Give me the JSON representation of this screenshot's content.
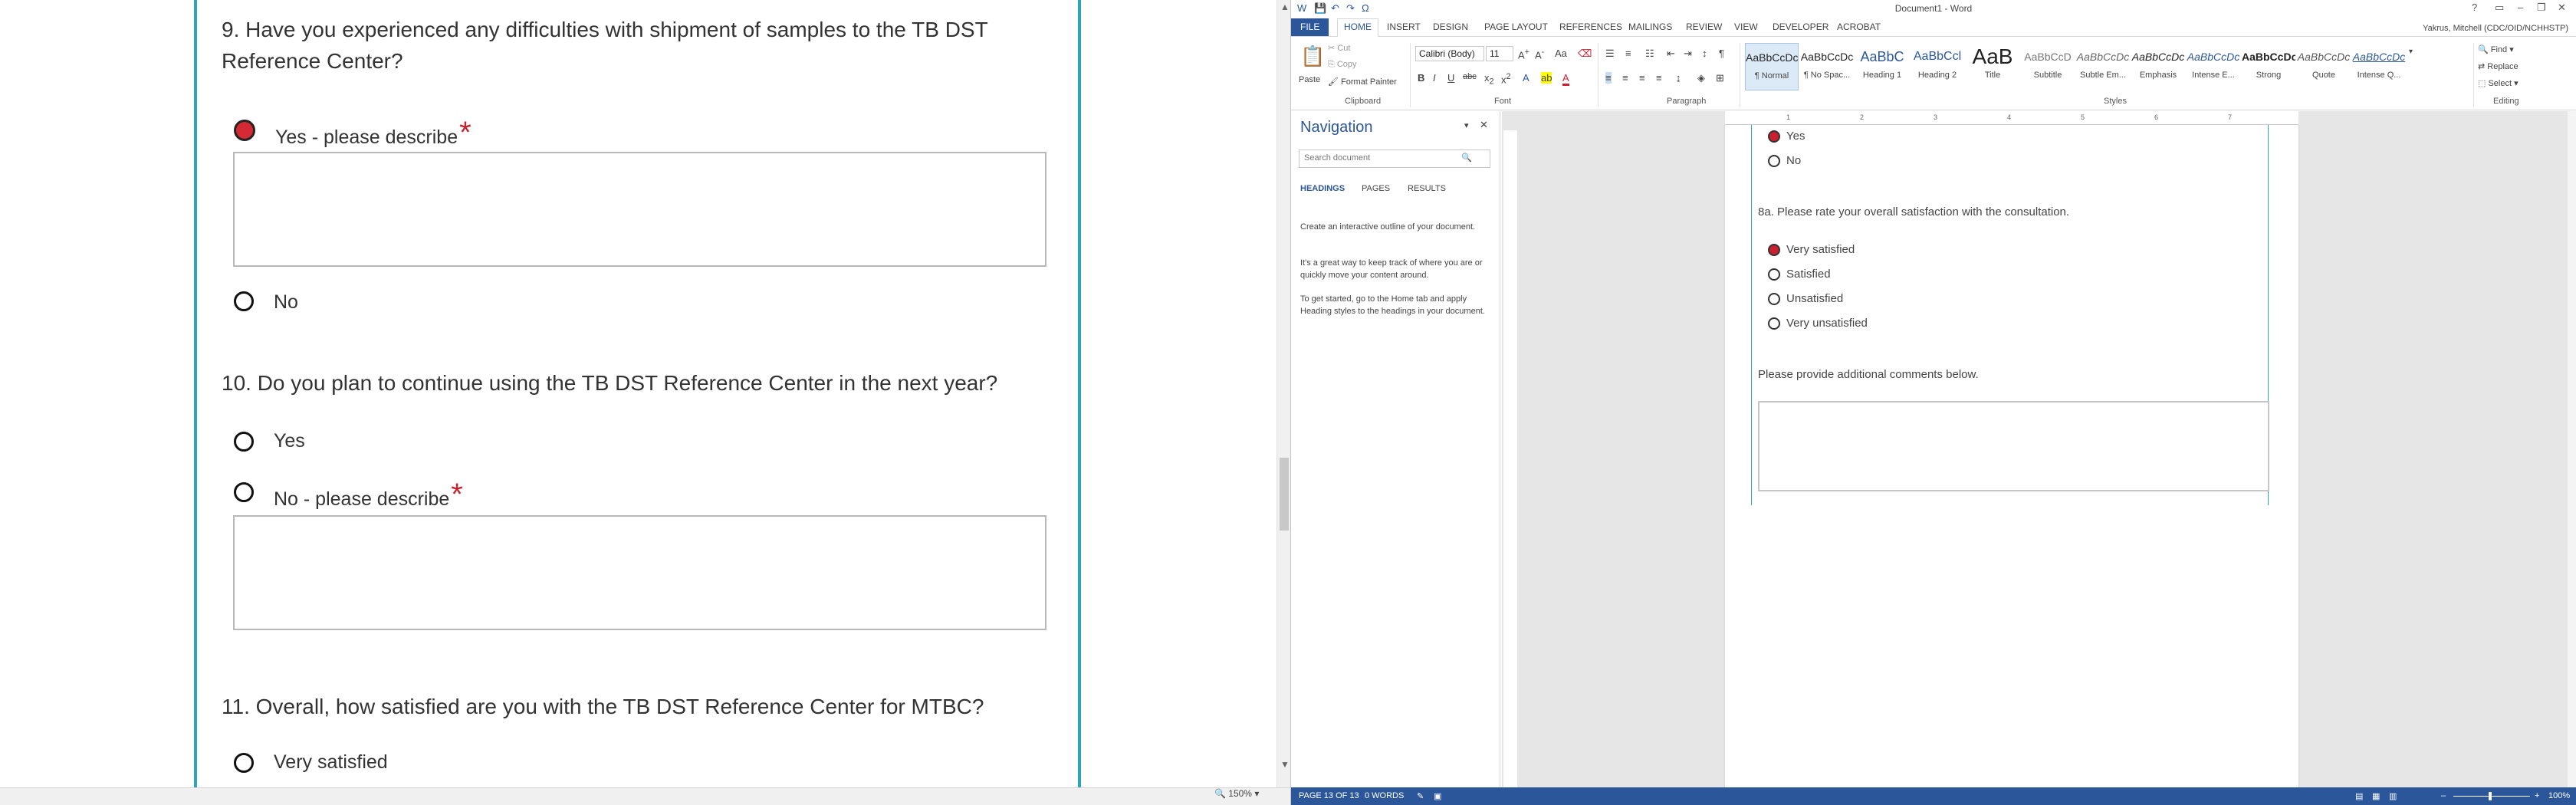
{
  "survey": {
    "q9": {
      "text": "9. Have you experienced any difficulties with shipment of samples to the TB DST Reference Center?",
      "opt_yes": "Yes - please describe",
      "opt_no": "No",
      "required": "*"
    },
    "q10": {
      "text": "10. Do you plan to continue using the TB DST Reference Center in the next year?",
      "opt_yes": "Yes",
      "opt_no": "No - please describe",
      "required": "*"
    },
    "q11": {
      "text": "11. Overall, how satisfied are you with the TB DST Reference Center for MTBC?",
      "opt_very": "Very satisfied"
    }
  },
  "left_status": {
    "zoom": "150%"
  },
  "word": {
    "title": "Document1 - Word",
    "user": "Yakrus, Mitchell (CDC/OID/NCHHSTP)",
    "tabs": [
      "FILE",
      "HOME",
      "INSERT",
      "DESIGN",
      "PAGE LAYOUT",
      "REFERENCES",
      "MAILINGS",
      "REVIEW",
      "VIEW",
      "DEVELOPER",
      "ACROBAT"
    ],
    "clipboard": {
      "paste": "Paste",
      "cut": "Cut",
      "copy": "Copy",
      "format_painter": "Format Painter",
      "label": "Clipboard"
    },
    "font": {
      "name": "Calibri (Body)",
      "size": "11",
      "label": "Font"
    },
    "paragraph": {
      "label": "Paragraph"
    },
    "styles": {
      "label": "Styles",
      "items": [
        {
          "preview": "AaBbCcDc",
          "name": "¶ Normal"
        },
        {
          "preview": "AaBbCcDc",
          "name": "¶ No Spac..."
        },
        {
          "preview": "AaBbC",
          "name": "Heading 1"
        },
        {
          "preview": "AaBbCcl",
          "name": "Heading 2"
        },
        {
          "preview": "AaB",
          "name": "Title"
        },
        {
          "preview": "AaBbCcD",
          "name": "Subtitle"
        },
        {
          "preview": "AaBbCcDc",
          "name": "Subtle Em..."
        },
        {
          "preview": "AaBbCcDc",
          "name": "Emphasis"
        },
        {
          "preview": "AaBbCcDc",
          "name": "Intense E..."
        },
        {
          "preview": "AaBbCcDc",
          "name": "Strong"
        },
        {
          "preview": "AaBbCcDc",
          "name": "Quote"
        },
        {
          "preview": "AaBbCcDc",
          "name": "Intense Q..."
        }
      ]
    },
    "editing": {
      "find": "Find",
      "replace": "Replace",
      "select": "Select",
      "label": "Editing"
    },
    "nav": {
      "title": "Navigation",
      "search_placeholder": "Search document",
      "tabs": [
        "HEADINGS",
        "PAGES",
        "RESULTS"
      ],
      "p1": "Create an interactive outline of your document.",
      "p2": "It's a great way to keep track of where you are or quickly move your content around.",
      "p3": "To get started, go to the Home tab and apply Heading styles to the headings in your document."
    },
    "ruler_ticks": [
      "1",
      "2",
      "3",
      "4",
      "5",
      "6",
      "7"
    ],
    "doc": {
      "yes": "Yes",
      "no": "No",
      "q8a": "8a. Please rate your overall satisfaction with the consultation.",
      "opts": [
        "Very satisfied",
        "Satisfied",
        "Unsatisfied",
        "Very unsatisfied"
      ],
      "comments": "Please provide additional comments below."
    },
    "status": {
      "page": "PAGE 13 OF 13",
      "words": "0 WORDS",
      "zoom": "100%"
    }
  }
}
